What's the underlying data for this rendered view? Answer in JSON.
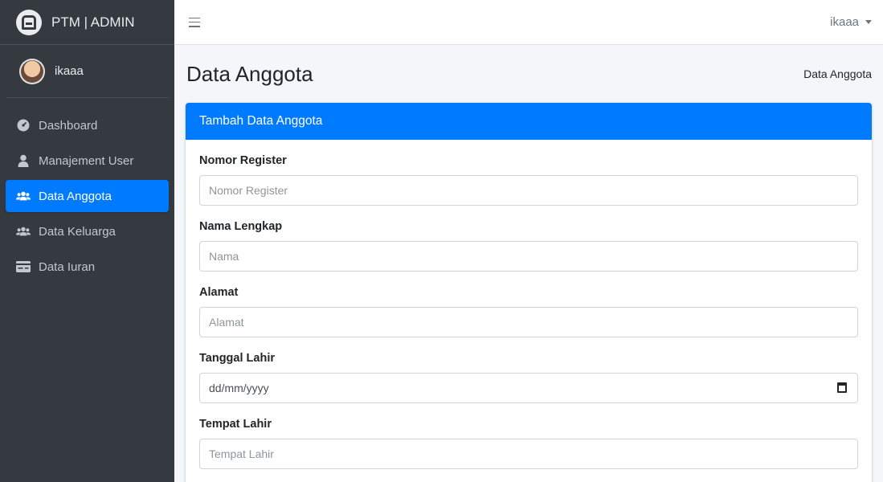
{
  "brand": {
    "text": "PTM | ADMIN"
  },
  "user": {
    "name": "ikaaa"
  },
  "nav": {
    "items": [
      {
        "label": "Dashboard",
        "icon": "tachometer-icon",
        "active": false
      },
      {
        "label": "Manajement User",
        "icon": "user-icon",
        "active": false
      },
      {
        "label": "Data Anggota",
        "icon": "users-icon",
        "active": true
      },
      {
        "label": "Data Keluarga",
        "icon": "users-icon",
        "active": false
      },
      {
        "label": "Data Iuran",
        "icon": "money-check-icon",
        "active": false
      }
    ]
  },
  "navbar": {
    "user_label": "ikaaa"
  },
  "header": {
    "title": "Data Anggota",
    "breadcrumb": "Data Anggota"
  },
  "card": {
    "title": "Tambah Data Anggota",
    "fields": [
      {
        "label": "Nomor Register",
        "placeholder": "Nomor Register",
        "type": "text"
      },
      {
        "label": "Nama Lengkap",
        "placeholder": "Nama",
        "type": "text"
      },
      {
        "label": "Alamat",
        "placeholder": "Alamat",
        "type": "text"
      },
      {
        "label": "Tanggal Lahir",
        "value": "dd/mm/yyyy",
        "type": "date"
      },
      {
        "label": "Tempat Lahir",
        "placeholder": "Tempat Lahir",
        "type": "text"
      }
    ]
  },
  "colors": {
    "sidebar": "#343a40",
    "accent": "#007bff",
    "background": "#f4f6f9"
  }
}
